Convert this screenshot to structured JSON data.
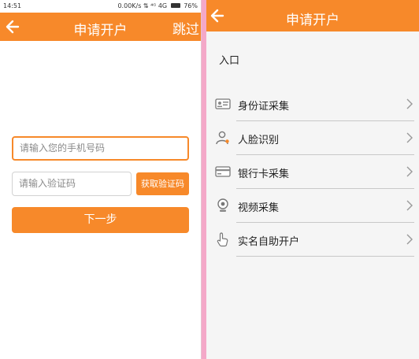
{
  "left": {
    "status": {
      "time": "14:51",
      "right": "0.00K/s ⇅ ⁴ᴳ 4G",
      "battery": "76%"
    },
    "header": {
      "title": "申请开户",
      "skip": "跳过"
    },
    "phone_placeholder": "请输入您的手机号码",
    "code_placeholder": "请输入验证码",
    "get_code_label": "获取验证码",
    "next_label": "下一步"
  },
  "right": {
    "header": {
      "title": "申请开户"
    },
    "entrance_label": "入口",
    "menu": [
      {
        "label": "身份证采集",
        "icon": "id-card-icon"
      },
      {
        "label": "人脸识别",
        "icon": "face-recognition-icon"
      },
      {
        "label": "银行卡采集",
        "icon": "bank-card-icon"
      },
      {
        "label": "视频采集",
        "icon": "video-camera-icon"
      },
      {
        "label": "实名自助开户",
        "icon": "hand-pointer-icon"
      }
    ]
  },
  "colors": {
    "accent": "#f7892a",
    "divider_bg": "#f4a8c8"
  }
}
